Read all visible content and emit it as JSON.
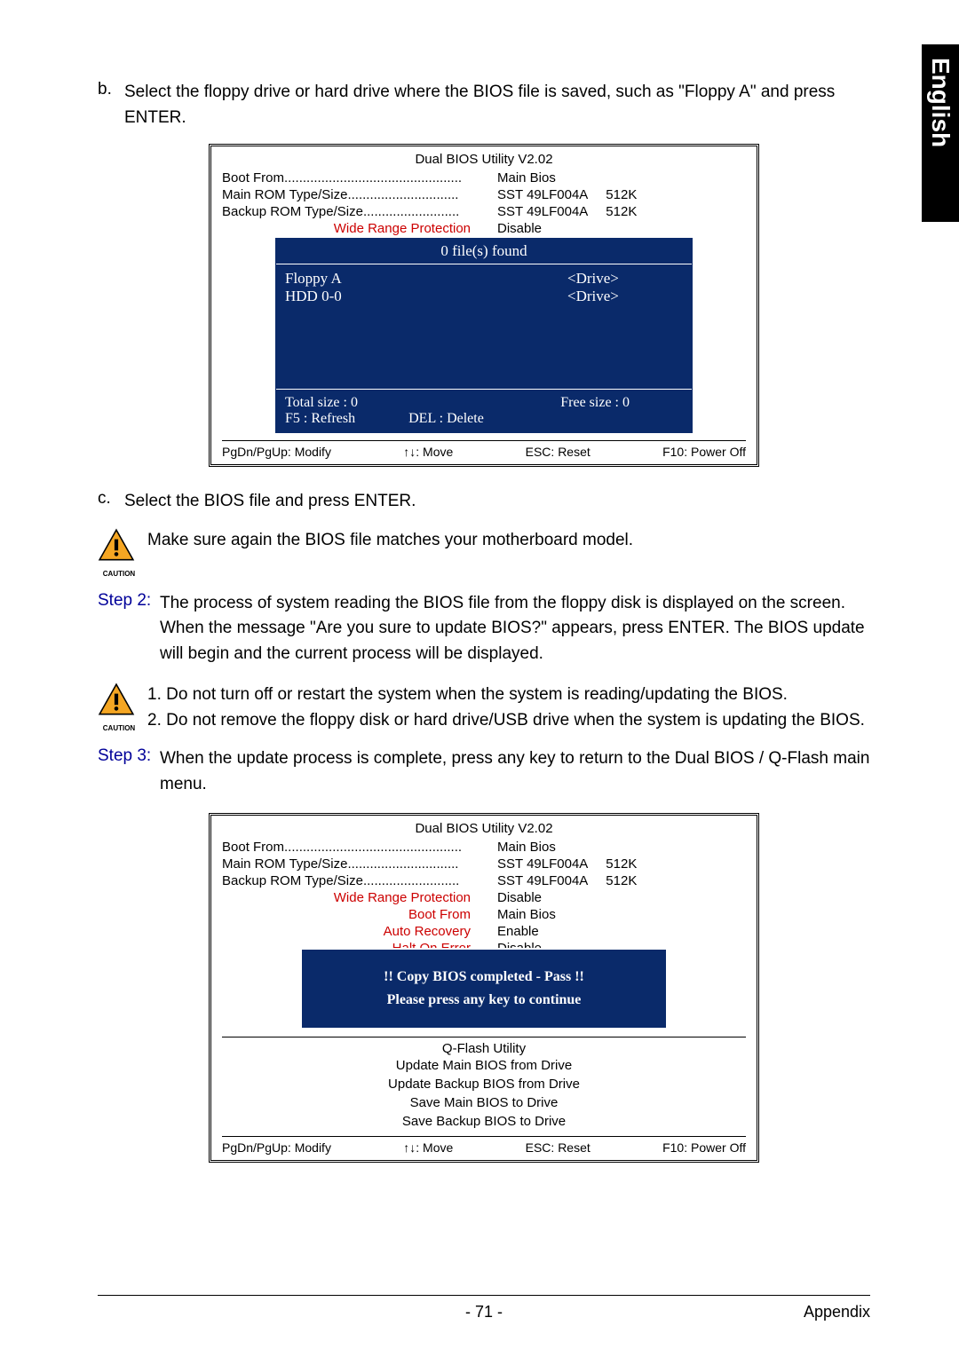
{
  "sideTab": "English",
  "instrB": {
    "letter": "b.",
    "text": "Select the floppy drive or hard drive where the BIOS file is saved, such as \"Floppy A\" and press ENTER."
  },
  "bios1": {
    "title": "Dual BIOS Utility V2.02",
    "bootFrom": {
      "label": "Boot From................................................",
      "value": "Main Bios"
    },
    "mainRom": {
      "label": "Main ROM Type/Size..............................",
      "value": "SST 49LF004A",
      "size": "512K"
    },
    "backupRom": {
      "label": "Backup ROM Type/Size..........................",
      "value": "SST 49LF004A",
      "size": "512K"
    },
    "wideRange": {
      "label": "Wide Range Protection",
      "value": "Disable"
    },
    "filesFound": "0 file(s) found",
    "drives": [
      {
        "name": "Floppy A",
        "type": "<Drive>"
      },
      {
        "name": "HDD 0-0",
        "type": "<Drive>"
      }
    ],
    "totalSize": "Total size : 0",
    "freeSize": "Free size : 0",
    "f5": "F5 : Refresh",
    "del": "DEL : Delete",
    "footer": {
      "pg": "PgDn/PgUp: Modify",
      "move": "↑↓: Move",
      "esc": "ESC: Reset",
      "f10": "F10: Power Off"
    }
  },
  "instrC": {
    "letter": "c.",
    "text": "Select the BIOS file and press ENTER."
  },
  "caution1": "Make sure again the BIOS file matches your motherboard model.",
  "step2": {
    "label": "Step 2:",
    "text": "The process of system reading the BIOS file from the floppy disk is displayed on the screen. When the message \"Are you sure to update BIOS?\" appears, press ENTER. The BIOS update will begin and the current process will be displayed."
  },
  "caution2": {
    "line1": "1. Do not turn off or restart the system when the system is reading/updating the BIOS.",
    "line2": "2. Do not remove the floppy disk or hard drive/USB drive when the system is updating the BIOS."
  },
  "step3": {
    "label": "Step 3:",
    "text": "When the update process is complete, press any key to return to the Dual BIOS / Q-Flash main menu."
  },
  "bios2": {
    "title": "Dual BIOS Utility V2.02",
    "bootFrom": {
      "label": "Boot From................................................",
      "value": "Main Bios"
    },
    "mainRom": {
      "label": "Main ROM Type/Size..............................",
      "value": "SST 49LF004A",
      "size": "512K"
    },
    "backupRom": {
      "label": "Backup ROM Type/Size..........................",
      "value": "SST 49LF004A",
      "size": "512K"
    },
    "wideRange": {
      "label": "Wide Range Protection",
      "value": "Disable"
    },
    "bootFromOpt": {
      "label": "Boot From",
      "value": "Main Bios"
    },
    "autoRecovery": {
      "label": "Auto Recovery",
      "value": "Enable"
    },
    "haltOnError": {
      "label": "Halt On Error",
      "value": "Disable"
    },
    "msg1": "!! Copy BIOS completed - Pass !!",
    "msg2": "Please press any key to continue",
    "qflashTitle": "Q-Flash Utility",
    "qflash": [
      "Update Main BIOS from Drive",
      "Update Backup BIOS from Drive",
      "Save Main BIOS to Drive",
      "Save Backup BIOS to Drive"
    ],
    "footer": {
      "pg": "PgDn/PgUp: Modify",
      "move": "↑↓: Move",
      "esc": "ESC: Reset",
      "f10": "F10: Power Off"
    }
  },
  "pageNum": "- 71 -",
  "appendix": "Appendix",
  "cautionLabel": "CAUTION"
}
